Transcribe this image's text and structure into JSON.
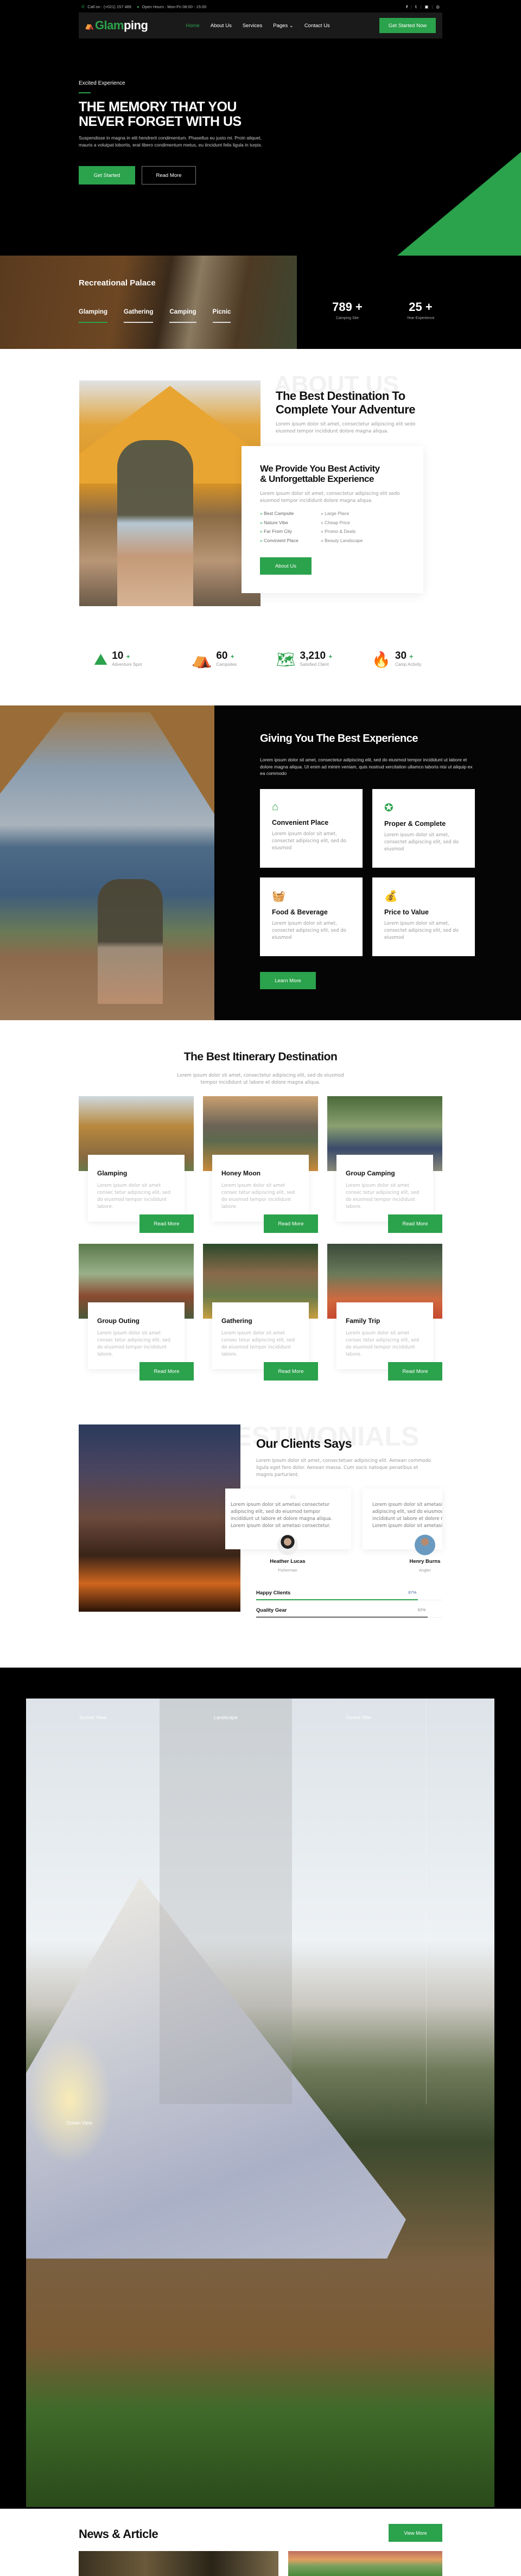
{
  "colors": {
    "accent": "#2ba24c",
    "dark": "#000000",
    "nav_bg": "#1a1a1a"
  },
  "topbar": {
    "phone": "Call on : (+021) 157 489",
    "hours": "Open Hours : Mon-Fri 08:00 - 15:00",
    "social": [
      "facebook-icon",
      "twitter-icon",
      "youtube-icon",
      "instagram-icon"
    ]
  },
  "nav": {
    "logo_a": "Glam",
    "logo_b": "ping",
    "items": [
      "Home",
      "About Us",
      "Services",
      "Pages",
      "Contact Us"
    ],
    "active": "Home",
    "cta": "Get Started Now"
  },
  "hero": {
    "eyebrow": "Excited Experience",
    "title_1": "THE MEMORY THAT YOU",
    "title_2": "NEVER FORGET WITH US",
    "text": "Suspendisse in magna in elit hendrerit condimentum. Phasellus eu justo mi. Proin aliquet, mauris a volutpat lobortis, erat libero condimentum metus, eu tincidunt felis ligula in turpis.",
    "btn_primary": "Get Started",
    "btn_secondary": "Read More"
  },
  "strip": {
    "title": "Recreational Palace",
    "tabs": [
      "Glamping",
      "Gathering",
      "Camping",
      "Picnic"
    ],
    "active_tab": "Glamping",
    "stats": [
      {
        "value": "789 +",
        "label": "Camping Site"
      },
      {
        "value": "25 +",
        "label": "Year Experience"
      }
    ]
  },
  "about": {
    "watermark": "ABOUT US",
    "title_1": "The Best Destination To",
    "title_2": "Complete Your Adventure",
    "text": "Lorem ipsum dolor sit amet, consectetur adipiscing elit sedo eiusmod tempor incididunt dolore magna aliqua.",
    "card_title_1": "We Provide You Best Activity",
    "card_title_2": "& Unforgettable Experience",
    "card_text": "Lorem ipsum dolor sit amet, consectetur adipiscing elit sedo eiusmod tempor incididunt dolore magna aliqua.",
    "list_left": [
      "Best Campsite",
      "Nature Vibe",
      "Far From City",
      "Convinient Place"
    ],
    "list_right": [
      "Large Place",
      "Cheap Price",
      "Promo & Deals",
      "Beauty Landscape"
    ],
    "button": "About Us"
  },
  "counters": [
    {
      "value": "10",
      "suffix": "+",
      "label": "Adventure Spot",
      "icon": "mountains-icon"
    },
    {
      "value": "60",
      "suffix": "+",
      "label": "Campsites",
      "icon": "tent-icon"
    },
    {
      "value": "3,210",
      "suffix": "+",
      "label": "Satisfied Client",
      "icon": "map-icon"
    },
    {
      "value": "30",
      "suffix": "+",
      "label": "Camp Activity",
      "icon": "campfire-icon"
    }
  ],
  "experience": {
    "title": "Giving You The Best Experience",
    "text": "Lorem ipsum dolor sit amet, consectetur adipiscing elit, sed do eiusmod tempor incididunt ut labore et dolore magna aliqua. Ut enim ad minim veniam, quis nostrud xercitation ullamco laboris nisi ut aliquip ex ea commodo",
    "cards": [
      {
        "title": "Convenient Place",
        "text": "Lorem ipsum dolor sit amet, consectet adipiscing elit, sed do eiusmod",
        "icon": "house-icon"
      },
      {
        "title": "Proper & Complete",
        "text": "Lorem ipsum dolor sit amet, consectet adipiscing elit, sed do eiusmod",
        "icon": "badge-thumbs-up-icon"
      },
      {
        "title": "Food & Beverage",
        "text": "Lorem ipsum dolor sit amet, consectet adipiscing elit, sed do eiusmod",
        "icon": "food-basket-icon"
      },
      {
        "title": "Price to Value",
        "text": "Lorem ipsum dolor sit amet, consectet adipiscing elit, sed do eiusmod",
        "icon": "money-bag-icon"
      }
    ],
    "button": "Learn More"
  },
  "itinerary": {
    "title": "The Best Itinerary Destination",
    "text_1": "Lorem ipsum dolor sit amet, consectetur adipiscing elit, sed do eiusmod",
    "text_2": "tempor incididunt ut labore et dolore magna aliqua.",
    "cards": [
      {
        "title": "Glamping",
        "text": "Lorem ipsum dolor sit amet consec tetur adipiscing elit, sed do eiusmod tempor incididunt labore.",
        "button": "Read More"
      },
      {
        "title": "Honey Moon",
        "text": "Lorem ipsum dolor sit amet consec tetur adipiscing elit, sed do eiusmod tempor incididunt labore.",
        "button": "Read More"
      },
      {
        "title": "Group Camping",
        "text": "Lorem ipsum dolor sit amet consec tetur adipiscing elit, sed do eiusmod tempor incididunt labore.",
        "button": "Read More"
      },
      {
        "title": "Group Outing",
        "text": "Lorem ipsum dolor sit amet consec tetur adipiscing elit, sed do eiusmod tempor incididunt labore.",
        "button": "Read More"
      },
      {
        "title": "Gathering",
        "text": "Lorem ipsum dolor sit amet consec tetur adipiscing elit, sed do eiusmod tempor incididunt labore.",
        "button": "Read More"
      },
      {
        "title": "Family Trip",
        "text": "Lorem ipsum dolor sit amet consec tetur adipiscing elit, sed do eiusmod tempor incididunt labore.",
        "button": "Read More"
      }
    ]
  },
  "testimonials": {
    "watermark": "TESTIMONIALS",
    "title": "Our Clients Says",
    "text": "Lorem ipsum dolor sit amet, consectetuer adipiscing elit. Aenean commodo ligula eget fero dolor. Aenean massa. Cum socis natoque penatibus et magnis parturient.",
    "items": [
      {
        "quote": "Lorem ipsum dolor sit ametasi consectetur adipiscing elit, sed do eiusmod tempor incididunt ut labore et dolore magna aliqua. Lorem ipsum dolor sit ametasi consectetur.",
        "name": "Heather Lucas",
        "role": "Fisherman"
      },
      {
        "quote": "Lorem ipsum dolor sit ametasi consectetur adipiscing elit, sed do eiusmod tempor incididunt ut labore et dolore magna aliqua. Lorem ipsum dolor sit ametasi consectetur.",
        "name": "Henry Burns",
        "role": "Angler"
      }
    ],
    "skills": [
      {
        "label": "Happy Clients",
        "percent": 87,
        "display": "87%"
      },
      {
        "label": "Quality Gear",
        "percent": 92,
        "display": "92%"
      }
    ]
  },
  "gallery": {
    "labels": [
      "Sunset View",
      "Landscape",
      "Forest Vibe",
      "Ocean View"
    ]
  },
  "news": {
    "title": "News & Article",
    "button": "View More"
  }
}
